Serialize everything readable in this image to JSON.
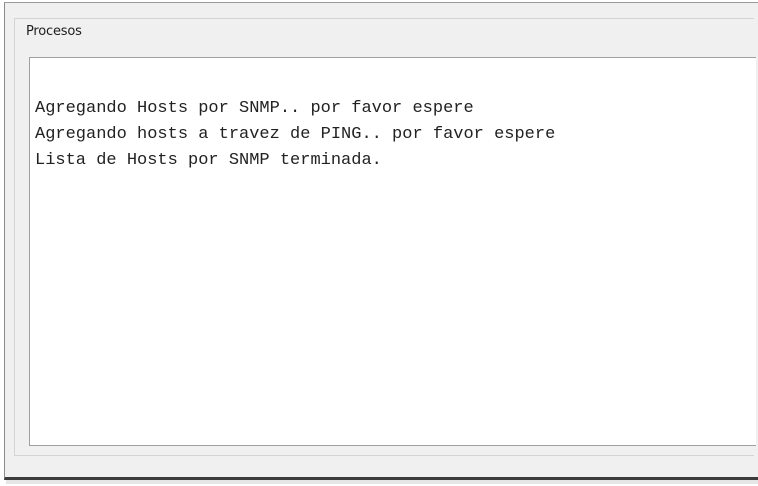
{
  "group": {
    "title": "Procesos"
  },
  "log": {
    "lines": [
      "Agregando Hosts por SNMP.. por favor espere",
      "Agregando hosts a travez de PING.. por favor espere",
      "Lista de Hosts por SNMP terminada."
    ]
  },
  "colors": {
    "window_background": "#f0f0f0",
    "log_background": "#ffffff",
    "text": "#222222"
  }
}
